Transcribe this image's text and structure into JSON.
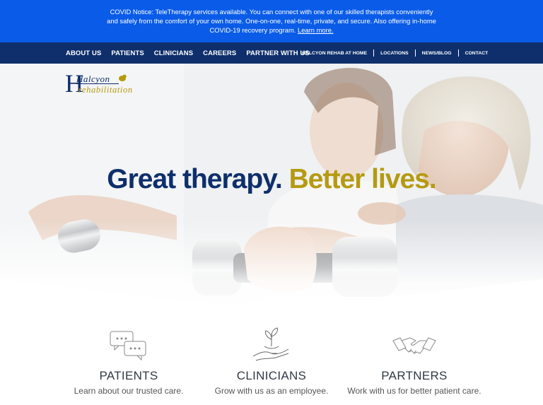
{
  "notice": {
    "text": "COVID Notice: TeleTherapy services available. You can connect with one of our skilled therapists conveniently and safely from the comfort of your own home. One-on-one, real-time, private, and secure. Also offering in-home COVID-19 recovery program.",
    "link": "Learn more."
  },
  "nav": {
    "primary": [
      "ABOUT US",
      "PATIENTS",
      "CLINICIANS",
      "CAREERS",
      "PARTNER WITH US"
    ],
    "secondary": [
      "HALCYON REHAB AT HOME",
      "LOCATIONS",
      "NEWS/BLOG",
      "CONTACT"
    ]
  },
  "logo": {
    "line1": "Halcyon",
    "line2": "rehabilitation"
  },
  "hero": {
    "headline_a": "Great therapy.",
    "headline_b": "Better lives."
  },
  "features": [
    {
      "icon": "chat-bubbles-icon",
      "title": "PATIENTS",
      "desc": "Learn about our trusted care."
    },
    {
      "icon": "plant-in-hand-icon",
      "title": "CLINICIANS",
      "desc": "Grow with us as an employee."
    },
    {
      "icon": "handshake-icon",
      "title": "PARTNERS",
      "desc": "Work with us for better patient care."
    }
  ],
  "colors": {
    "notice_bg": "#0a5ce8",
    "nav_bg": "#0e2f6b",
    "navy": "#0e2f6b",
    "gold": "#b59a12"
  }
}
